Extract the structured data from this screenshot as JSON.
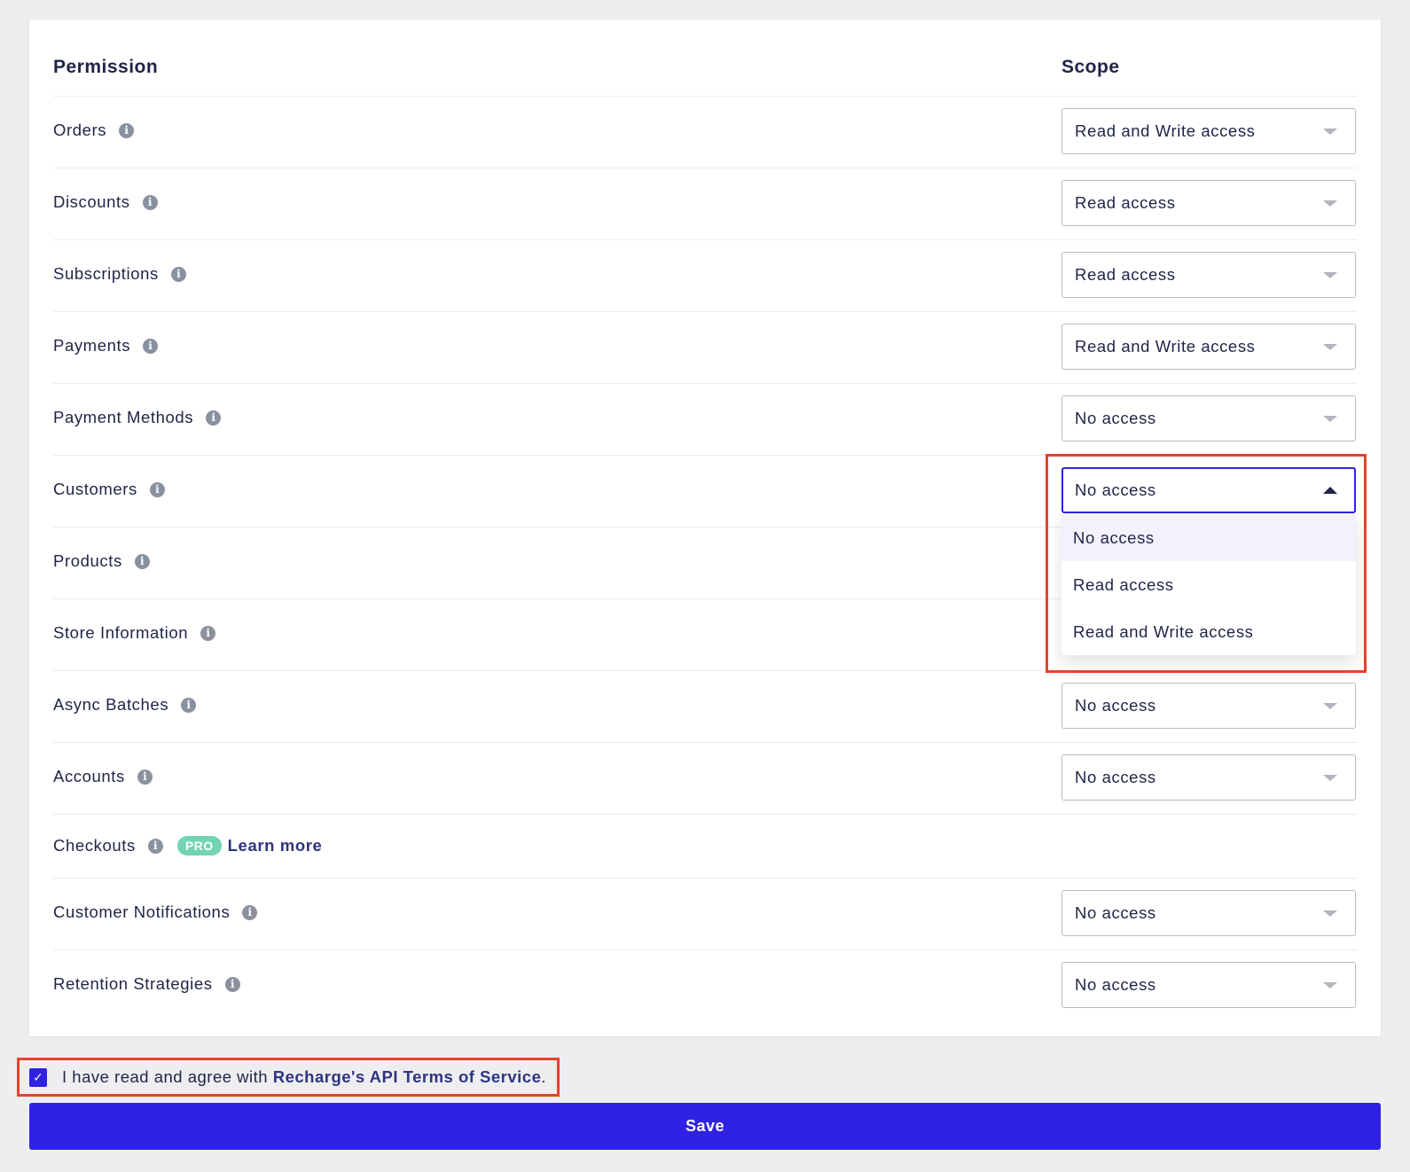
{
  "table": {
    "header_permission": "Permission",
    "header_scope": "Scope"
  },
  "rows": [
    {
      "label": "Orders",
      "scope": "Read and Write access"
    },
    {
      "label": "Discounts",
      "scope": "Read access"
    },
    {
      "label": "Subscriptions",
      "scope": "Read access"
    },
    {
      "label": "Payments",
      "scope": "Read and Write access"
    },
    {
      "label": "Payment Methods",
      "scope": "No access"
    },
    {
      "label": "Customers",
      "scope": "No access"
    },
    {
      "label": "Products",
      "scope": ""
    },
    {
      "label": "Store Information",
      "scope": ""
    },
    {
      "label": "Async Batches",
      "scope": "No access"
    },
    {
      "label": "Accounts",
      "scope": "No access"
    },
    {
      "label": "Checkouts",
      "badge": "PRO",
      "link": "Learn more"
    },
    {
      "label": "Customer Notifications",
      "scope": "No access"
    },
    {
      "label": "Retention Strategies",
      "scope": "No access"
    }
  ],
  "dropdown": {
    "open_for": "Customers",
    "options": [
      "No access",
      "Read access",
      "Read and Write access"
    ],
    "highlighted": "No access"
  },
  "icons": {
    "info": "i",
    "check": "✓"
  },
  "terms": {
    "checked": true,
    "prefix": "I have read and agree with ",
    "link": "Recharge's API Terms of Service",
    "suffix": "."
  },
  "save_label": "Save",
  "colors": {
    "primary": "#2f22e3",
    "highlight_box": "#e5432c",
    "pro_badge": "#72d3b5",
    "link": "#2e3480",
    "text": "#1f2447"
  }
}
